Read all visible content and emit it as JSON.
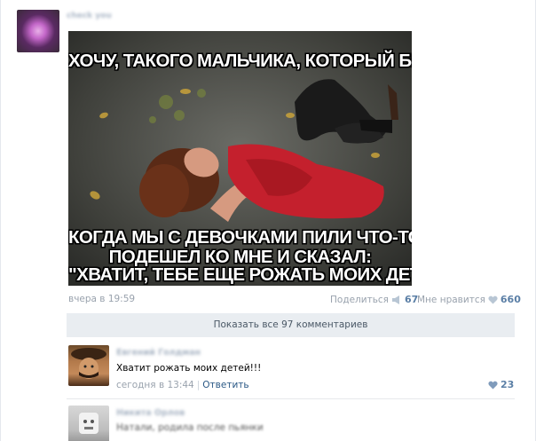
{
  "post": {
    "author_name": "check you",
    "meme_top": "ХОЧУ, ТАКОГО МАЛЬЧИКА, КОТОРЫЙ БЫ,",
    "meme_bottom": [
      "КОГДА МЫ С ДЕВОЧКАМИ ПИЛИ ЧТО-ТО,",
      "ПОДЕШЕЛ КО МНЕ И СКАЗАЛ:",
      "\"ХВАТИТ, ТЕБЕ ЕЩЕ РОЖАТЬ МОИХ ДЕТЕЙ!\""
    ],
    "timestamp": "вчера в 19:59",
    "share_label": "Поделиться",
    "share_count": "67",
    "like_label": "Мне нравится",
    "like_count": "660"
  },
  "comments_bar": {
    "show_all_label": "Показать все 97 комментариев"
  },
  "comments": [
    {
      "author": "Евгений Голдман",
      "text": "Хватит рожать моих детей!!!",
      "time": "сегодня в 13:44",
      "reply_label": "Ответить",
      "likes": "23"
    },
    {
      "author": "Никита Орлов",
      "text": "Натали, родила после пьянки"
    }
  ],
  "colors": {
    "link": "#2a5885",
    "meta": "#99a2ad",
    "like_count": "#5b7fa6",
    "bar_bg": "#e9edf1"
  }
}
